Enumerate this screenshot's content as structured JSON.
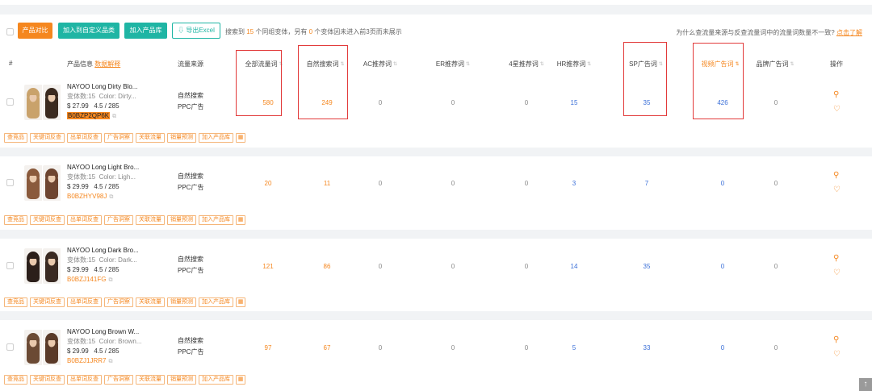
{
  "toolbar": {
    "compare_label": "产品对比",
    "add_category_label": "加入到自定义品类",
    "add_library_label": "加入产品库",
    "export_label": "导出Excel",
    "summary_pre": "搜索到",
    "summary_count": "15",
    "summary_mid": "个同组变体，另有",
    "summary_excluded": "0",
    "summary_post": "个变体因未进入前3页而未展示",
    "help_text": "为什么查流量来源与反查流量词中的流量词数量不一致?",
    "help_link": "点击了解"
  },
  "columns": {
    "index": "#",
    "product_info": "产品信息",
    "data_explain": "数据解释",
    "traffic_source": "流量来源",
    "all_keywords": "全部流量词",
    "organic": "自然搜索词",
    "ac": "AC推荐词",
    "er": "ER推荐词",
    "four_star": "4星推荐词",
    "hr": "HR推荐词",
    "sp": "SP广告词",
    "video": "视频广告词",
    "brand": "品牌广告词",
    "action": "操作"
  },
  "source_labels": [
    "自然搜索",
    "PPC广告"
  ],
  "tags": [
    "查竞品",
    "关键词反查",
    "出单词反查",
    "广告洞察",
    "关联流量",
    "销量预测",
    "加入产品库"
  ],
  "rows": [
    {
      "title": "NAYOO Long Dirty Blo...",
      "variants": "变体数:15",
      "color": "Color: Dirty...",
      "price": "$ 27.99",
      "rating": "4.5 / 285",
      "asin": "B0BZP2QP6K",
      "asin_marked": true,
      "all": "580",
      "organic": "249",
      "ac": "0",
      "er": "0",
      "four_star": "0",
      "hr": "15",
      "sp": "35",
      "video": "426",
      "brand": "0"
    },
    {
      "title": "NAYOO Long Light Bro...",
      "variants": "变体数:15",
      "color": "Color: Ligh...",
      "price": "$ 29.99",
      "rating": "4.5 / 285",
      "asin": "B0BZHYV98J",
      "asin_marked": false,
      "all": "20",
      "organic": "11",
      "ac": "0",
      "er": "0",
      "four_star": "0",
      "hr": "3",
      "sp": "7",
      "video": "0",
      "brand": "0"
    },
    {
      "title": "NAYOO Long Dark Bro...",
      "variants": "变体数:15",
      "color": "Color: Dark...",
      "price": "$ 29.99",
      "rating": "4.5 / 285",
      "asin": "B0BZJ141FG",
      "asin_marked": false,
      "all": "121",
      "organic": "86",
      "ac": "0",
      "er": "0",
      "four_star": "0",
      "hr": "14",
      "sp": "35",
      "video": "0",
      "brand": "0"
    },
    {
      "title": "NAYOO Long Brown W...",
      "variants": "变体数:15",
      "color": "Color: Brown...",
      "price": "$ 29.99",
      "rating": "4.5 / 285",
      "asin": "B0BZJ1JRR7",
      "asin_marked": false,
      "all": "97",
      "organic": "67",
      "ac": "0",
      "er": "0",
      "four_star": "0",
      "hr": "5",
      "sp": "33",
      "video": "0",
      "brand": "0"
    }
  ],
  "icons": {
    "search": "search-icon",
    "favorite": "heart-icon",
    "calculator": "calculator-icon",
    "external": "external-link-icon",
    "sort": "sort-icon",
    "export": "download-icon",
    "scroll_top": "arrow-up-icon"
  },
  "colors": {
    "accent": "#f5871f",
    "teal": "#1fb5a4",
    "blue_value": "#3a6fd8",
    "highlight_box": "#e23a3a"
  }
}
